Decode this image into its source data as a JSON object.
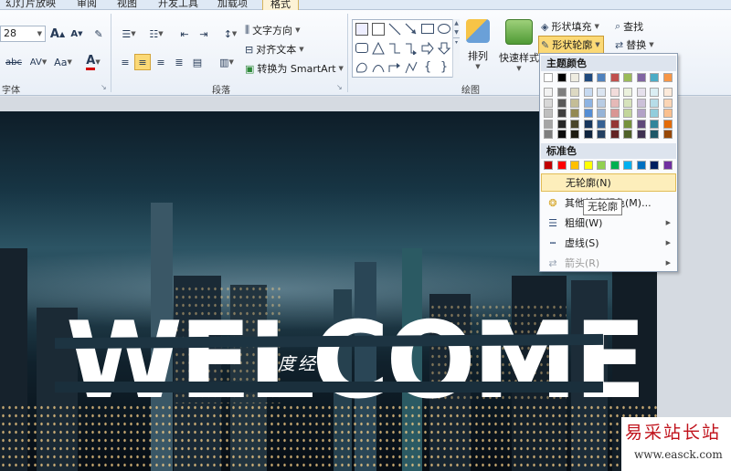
{
  "tabs": [
    {
      "label": "幻灯片放映",
      "active": false
    },
    {
      "label": "审阅",
      "active": false
    },
    {
      "label": "视图",
      "active": false
    },
    {
      "label": "开发工具",
      "active": false
    },
    {
      "label": "加载项",
      "active": false
    },
    {
      "label": "格式",
      "active": true
    }
  ],
  "font_group": {
    "size_value": "28",
    "grow_icon": "A",
    "shrink_icon": "A",
    "spacing_label": "AV",
    "case_label": "Aa",
    "color_label": "A",
    "strike_label": "abc",
    "label": "字体"
  },
  "paragraph_group": {
    "text_direction": "文字方向",
    "align_text": "对齐文本",
    "convert_smartart": "转换为 SmartArt",
    "label": "段落"
  },
  "drawing_group": {
    "arrange": "排列",
    "quick_styles": "快速样式",
    "shape_fill": "形状填充",
    "shape_outline": "形状轮廓",
    "label": "绘图"
  },
  "editing_group": {
    "find": "查找",
    "replace": "替换"
  },
  "menu": {
    "theme_colors_title": "主题颜色",
    "standard_colors_title": "标准色",
    "theme_top_row": [
      "#ffffff",
      "#000000",
      "#eeece1",
      "#1f497d",
      "#4f81bd",
      "#c0504d",
      "#9bbb59",
      "#8064a2",
      "#4bacc6",
      "#f79646"
    ],
    "theme_columns": [
      [
        "#f2f2f2",
        "#d8d8d8",
        "#bfbfbf",
        "#a5a5a5",
        "#7f7f7f"
      ],
      [
        "#7f7f7f",
        "#595959",
        "#3f3f3f",
        "#262626",
        "#0c0c0c"
      ],
      [
        "#ddd9c3",
        "#c4bd97",
        "#938953",
        "#494429",
        "#1d1b10"
      ],
      [
        "#c6d9f0",
        "#8db3e2",
        "#548dd4",
        "#17365d",
        "#0f243e"
      ],
      [
        "#dbe5f1",
        "#b8cce4",
        "#95b3d7",
        "#366092",
        "#244061"
      ],
      [
        "#f2dcdb",
        "#e5b9b7",
        "#d99694",
        "#953734",
        "#632423"
      ],
      [
        "#ebf1dd",
        "#d7e3bc",
        "#c3d69b",
        "#76923c",
        "#4f6128"
      ],
      [
        "#e5e0ec",
        "#ccc1d9",
        "#b2a2c7",
        "#5f497a",
        "#3f3151"
      ],
      [
        "#dbeef3",
        "#b7dde8",
        "#92cddc",
        "#31859b",
        "#205867"
      ],
      [
        "#fdeada",
        "#fbd5b5",
        "#fac08f",
        "#e36c09",
        "#974806"
      ]
    ],
    "standard_colors": [
      "#c00000",
      "#ff0000",
      "#ffc000",
      "#ffff00",
      "#92d050",
      "#00b050",
      "#00b0f0",
      "#0070c0",
      "#002060",
      "#7030a0"
    ],
    "no_outline": "无轮廓(N)",
    "more_colors": "其他轮廓颜色(M)...",
    "weight": "粗细(W)",
    "dashes": "虚线(S)",
    "arrows": "箭头(R)",
    "tooltip": "无轮廓"
  },
  "slide": {
    "headline": "WELCOME",
    "subtitle": "百度经验"
  },
  "watermark": {
    "title": "易采站长站",
    "url": "www.easck.com"
  }
}
